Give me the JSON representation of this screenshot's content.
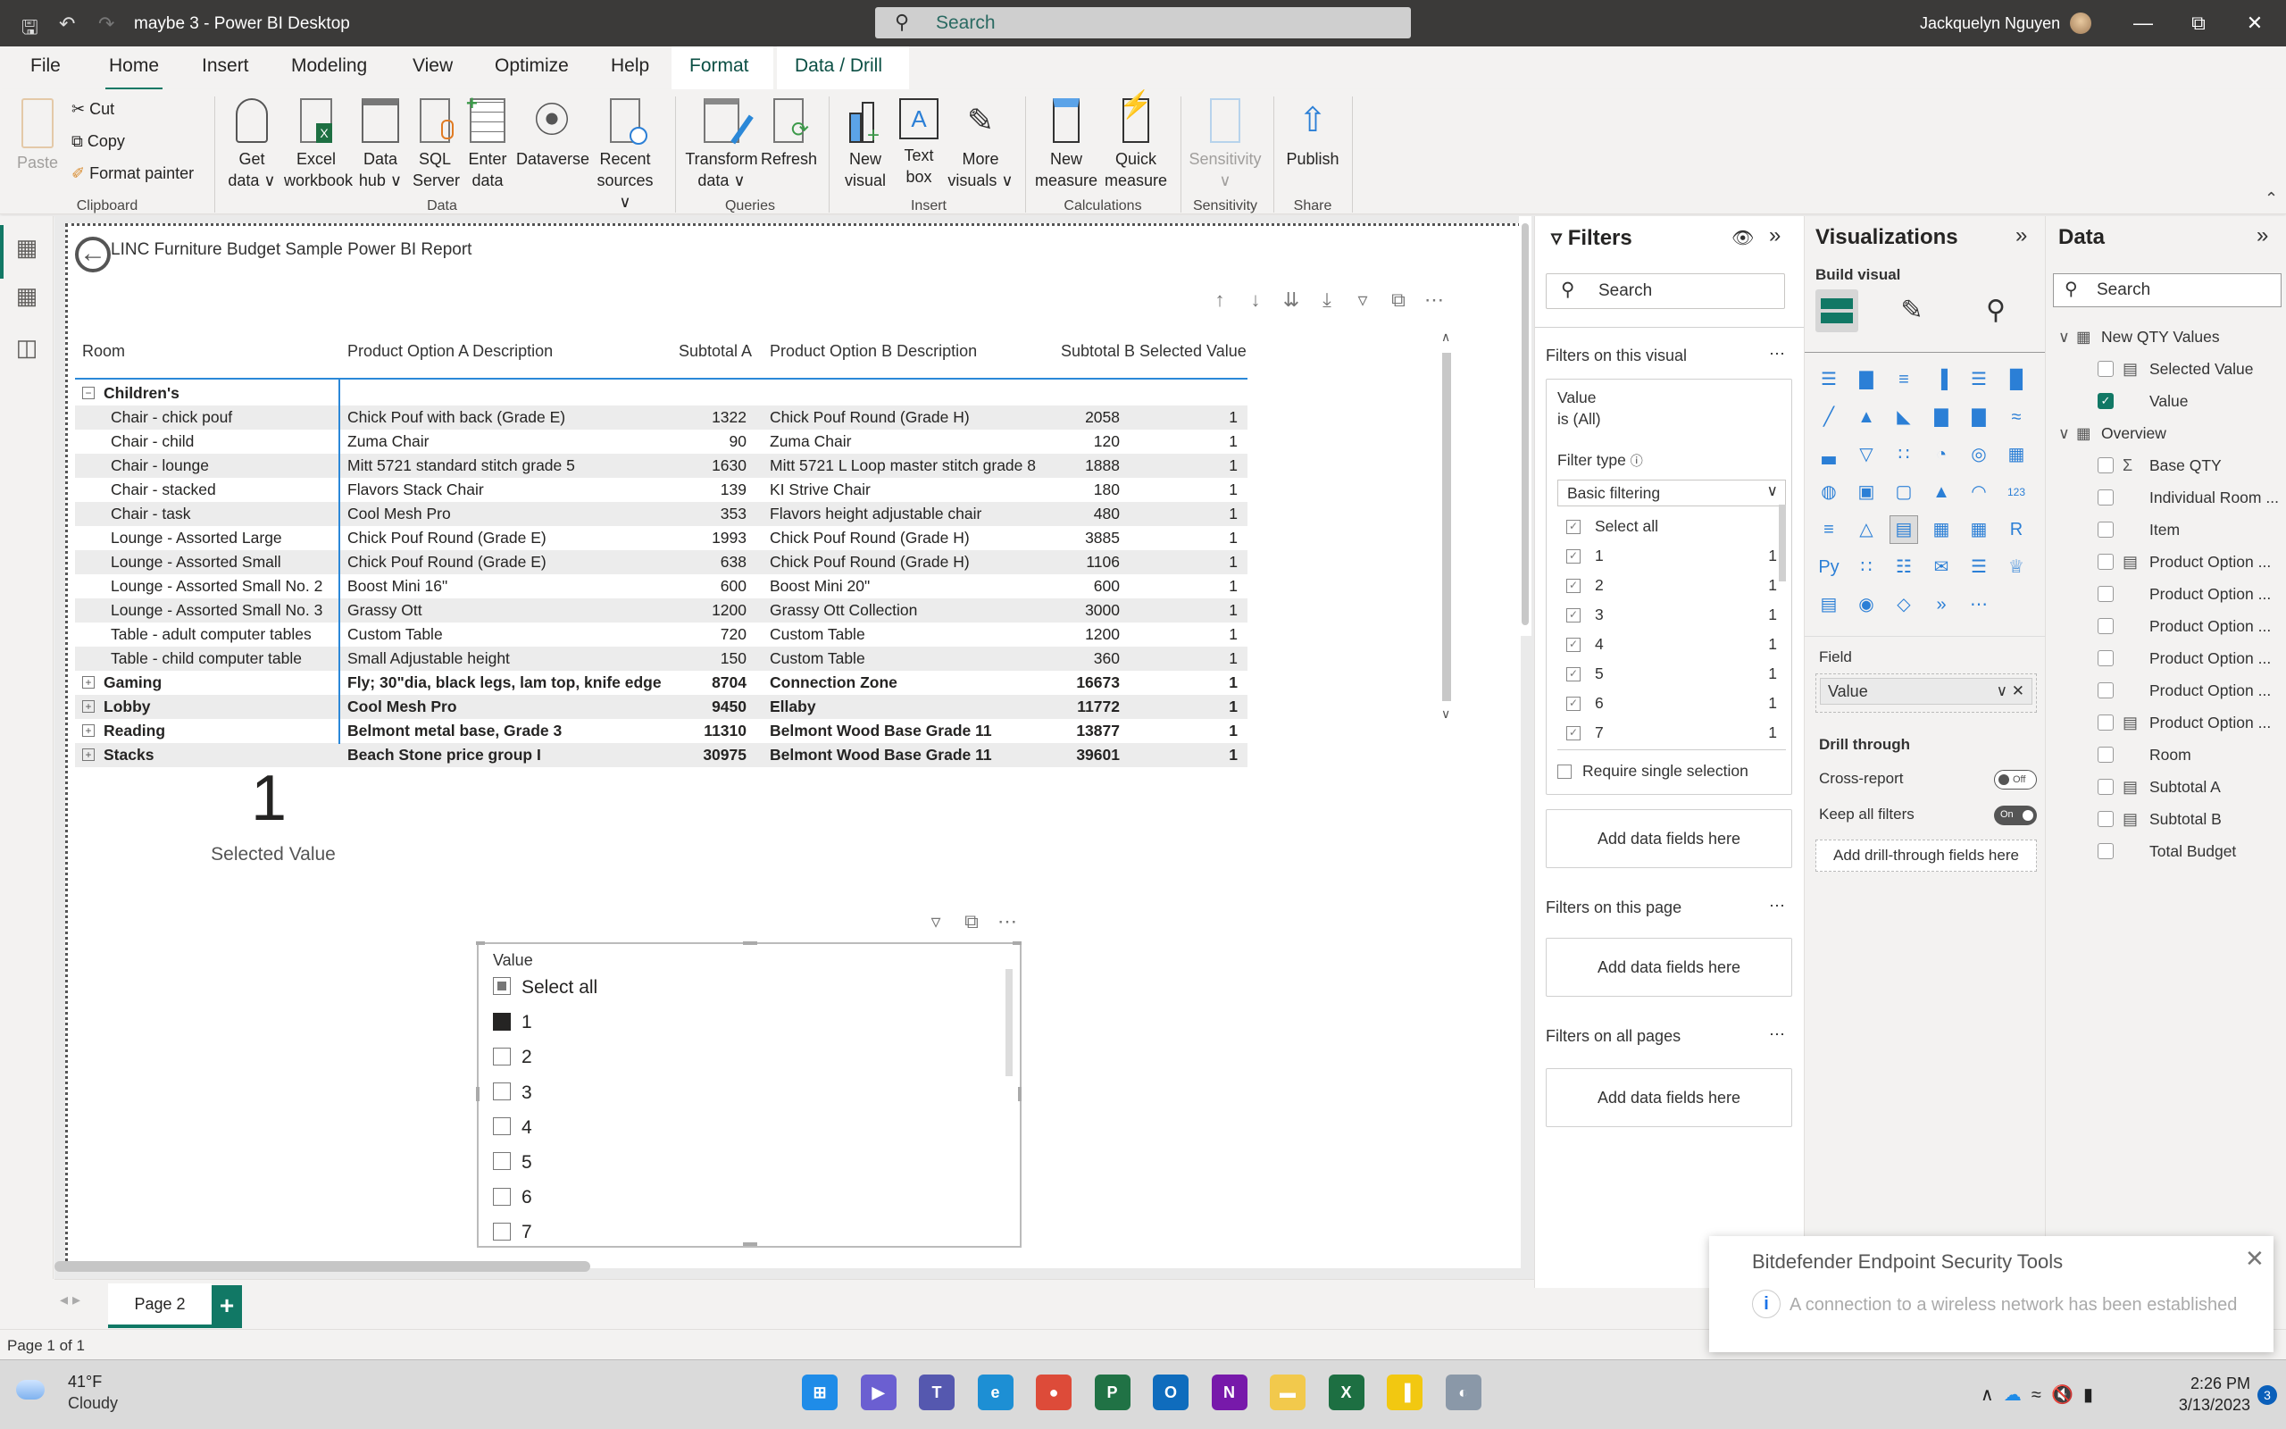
{
  "window": {
    "title": "maybe 3 - Power BI Desktop",
    "search_placeholder": "Search",
    "user_name": "Jackquelyn Nguyen"
  },
  "menu": {
    "tabs": [
      "File",
      "Home",
      "Insert",
      "Modeling",
      "View",
      "Optimize",
      "Help"
    ],
    "active_tab": "Home",
    "context_tabs": [
      "Format",
      "Data / Drill"
    ]
  },
  "ribbon": {
    "clipboard": {
      "paste": "Paste",
      "cut": "Cut",
      "copy": "Copy",
      "format_painter": "Format painter",
      "group": "Clipboard"
    },
    "data": {
      "buttons": [
        {
          "l1": "Get",
          "l2": "data ∨"
        },
        {
          "l1": "Excel",
          "l2": "workbook"
        },
        {
          "l1": "Data",
          "l2": "hub ∨"
        },
        {
          "l1": "SQL",
          "l2": "Server"
        },
        {
          "l1": "Enter",
          "l2": "data"
        },
        {
          "l1": "Dataverse",
          "l2": ""
        },
        {
          "l1": "Recent",
          "l2": "sources ∨"
        }
      ],
      "group": "Data"
    },
    "queries": {
      "transform_l1": "Transform",
      "transform_l2": "data ∨",
      "refresh": "Refresh",
      "group": "Queries"
    },
    "insert": {
      "new_visual_l1": "New",
      "new_visual_l2": "visual",
      "text_box_l1": "Text",
      "text_box_l2": "box",
      "more_visuals_l1": "More",
      "more_visuals_l2": "visuals ∨",
      "group": "Insert"
    },
    "calculations": {
      "new_measure_l1": "New",
      "new_measure_l2": "measure",
      "quick_measure_l1": "Quick",
      "quick_measure_l2": "measure",
      "group": "Calculations"
    },
    "sensitivity": {
      "label": "Sensitivity",
      "group": "Sensitivity"
    },
    "share": {
      "publish": "Publish",
      "group": "Share"
    }
  },
  "report": {
    "title": "LINC Furniture Budget Sample Power BI Report",
    "matrix": {
      "headers": [
        "Room",
        "Product Option A Description",
        "Subtotal A",
        "Product Option B Description",
        "Subtotal B",
        "Selected Value"
      ],
      "rows": [
        {
          "level": 0,
          "expander": "⊟",
          "room": "Children's",
          "a_desc": "",
          "a_sub": "",
          "b_desc": "",
          "b_sub": "",
          "sel": ""
        },
        {
          "level": 1,
          "room": "Chair - chick pouf",
          "a_desc": "Chick Pouf with back (Grade E)",
          "a_sub": "1322",
          "b_desc": "Chick Pouf Round (Grade H)",
          "b_sub": "2058",
          "sel": "1"
        },
        {
          "level": 1,
          "room": "Chair - child",
          "a_desc": "Zuma Chair",
          "a_sub": "90",
          "b_desc": "Zuma Chair",
          "b_sub": "120",
          "sel": "1"
        },
        {
          "level": 1,
          "room": "Chair - lounge",
          "a_desc": "Mitt 5721 standard stitch grade 5",
          "a_sub": "1630",
          "b_desc": "Mitt 5721 L Loop master stitch grade 8",
          "b_sub": "1888",
          "sel": "1"
        },
        {
          "level": 1,
          "room": "Chair - stacked",
          "a_desc": "Flavors Stack Chair",
          "a_sub": "139",
          "b_desc": "KI Strive Chair",
          "b_sub": "180",
          "sel": "1"
        },
        {
          "level": 1,
          "room": "Chair - task",
          "a_desc": "Cool Mesh Pro",
          "a_sub": "353",
          "b_desc": "Flavors height adjustable chair",
          "b_sub": "480",
          "sel": "1"
        },
        {
          "level": 1,
          "room": "Lounge - Assorted Large",
          "a_desc": "Chick Pouf Round (Grade E)",
          "a_sub": "1993",
          "b_desc": "Chick Pouf Round (Grade H)",
          "b_sub": "3885",
          "sel": "1"
        },
        {
          "level": 1,
          "room": "Lounge - Assorted Small",
          "a_desc": "Chick Pouf Round (Grade E)",
          "a_sub": "638",
          "b_desc": "Chick Pouf Round (Grade H)",
          "b_sub": "1106",
          "sel": "1"
        },
        {
          "level": 1,
          "room": "Lounge - Assorted Small No. 2",
          "a_desc": "Boost Mini 16\"",
          "a_sub": "600",
          "b_desc": "Boost Mini 20\"",
          "b_sub": "600",
          "sel": "1"
        },
        {
          "level": 1,
          "room": "Lounge - Assorted Small No. 3",
          "a_desc": "Grassy Ott",
          "a_sub": "1200",
          "b_desc": "Grassy Ott Collection",
          "b_sub": "3000",
          "sel": "1"
        },
        {
          "level": 1,
          "room": "Table - adult computer tables",
          "a_desc": "Custom Table",
          "a_sub": "720",
          "b_desc": "Custom Table",
          "b_sub": "1200",
          "sel": "1"
        },
        {
          "level": 1,
          "room": "Table - child computer table",
          "a_desc": "Small Adjustable height",
          "a_sub": "150",
          "b_desc": "Custom Table",
          "b_sub": "360",
          "sel": "1"
        },
        {
          "level": 0,
          "expander": "⊞",
          "room": "Gaming",
          "a_desc": "Fly; 30\"dia, black legs, lam top, knife edge",
          "a_sub": "8704",
          "b_desc": "Connection Zone",
          "b_sub": "16673",
          "sel": "1"
        },
        {
          "level": 0,
          "expander": "⊞",
          "room": "Lobby",
          "a_desc": "Cool Mesh Pro",
          "a_sub": "9450",
          "b_desc": "Ellaby",
          "b_sub": "11772",
          "sel": "1"
        },
        {
          "level": 0,
          "expander": "⊞",
          "room": "Reading",
          "a_desc": "Belmont metal base, Grade 3",
          "a_sub": "11310",
          "b_desc": "Belmont Wood Base Grade 11",
          "b_sub": "13877",
          "sel": "1"
        },
        {
          "level": 0,
          "expander": "⊞",
          "room": "Stacks",
          "a_desc": "Beach Stone price group I",
          "a_sub": "30975",
          "b_desc": "Belmont Wood Base Grade 11",
          "b_sub": "39601",
          "sel": "1"
        }
      ]
    },
    "card": {
      "value": "1",
      "label": "Selected Value"
    },
    "slicer": {
      "title": "Value",
      "items": [
        {
          "label": "Select all",
          "state": "partial"
        },
        {
          "label": "1",
          "state": "checked"
        },
        {
          "label": "2",
          "state": "unchecked"
        },
        {
          "label": "3",
          "state": "unchecked"
        },
        {
          "label": "4",
          "state": "unchecked"
        },
        {
          "label": "5",
          "state": "unchecked"
        },
        {
          "label": "6",
          "state": "unchecked"
        },
        {
          "label": "7",
          "state": "unchecked"
        }
      ]
    }
  },
  "pages": {
    "tabs": [
      "Page 2"
    ],
    "add": "+",
    "status": "Page 1 of 1"
  },
  "filters": {
    "title": "Filters",
    "search_placeholder": "Search",
    "on_visual": "Filters on this visual",
    "card": {
      "field": "Value",
      "condition": "is (All)",
      "filter_type_label": "Filter type",
      "filter_type": "Basic filtering",
      "items": [
        {
          "label": "Select all",
          "count": ""
        },
        {
          "label": "1",
          "count": "1"
        },
        {
          "label": "2",
          "count": "1"
        },
        {
          "label": "3",
          "count": "1"
        },
        {
          "label": "4",
          "count": "1"
        },
        {
          "label": "5",
          "count": "1"
        },
        {
          "label": "6",
          "count": "1"
        },
        {
          "label": "7",
          "count": "1"
        }
      ],
      "require_single": "Require single selection"
    },
    "add_fields": "Add data fields here",
    "on_page": "Filters on this page",
    "on_all_pages": "Filters on all pages"
  },
  "visualizations": {
    "title": "Visualizations",
    "build_visual": "Build visual",
    "field_label": "Field",
    "field_value": "Value",
    "drill_through": "Drill through",
    "cross_report": "Cross-report",
    "cross_report_state": "Off",
    "keep_filters": "Keep all filters",
    "keep_filters_state": "On",
    "add_drill": "Add drill-through fields here",
    "icons": [
      "stacked-bar",
      "stacked-column",
      "clustered-bar",
      "clustered-column",
      "100-bar",
      "100-column",
      "line",
      "area",
      "stacked-area",
      "line-column",
      "line-clustered",
      "ribbon",
      "waterfall",
      "funnel",
      "scatter",
      "pie",
      "donut",
      "treemap",
      "map",
      "filled-map",
      "shape-map",
      "azure-map",
      "gauge",
      "card",
      "multi-row-card",
      "kpi",
      "slicer",
      "table",
      "matrix",
      "r-visual",
      "python-visual",
      "key-influencers",
      "decomposition-tree",
      "qa",
      "smart-narrative",
      "metrics",
      "paginated",
      "arcgis",
      "power-apps",
      "power-automate",
      "more"
    ]
  },
  "data_pane": {
    "title": "Data",
    "search_placeholder": "Search",
    "tables": [
      {
        "name": "New QTY Values",
        "fields": [
          {
            "name": "Selected Value",
            "checked": false,
            "icon": "calc"
          },
          {
            "name": "Value",
            "checked": true,
            "icon": ""
          }
        ]
      },
      {
        "name": "Overview",
        "fields": [
          {
            "name": "Base QTY",
            "checked": false,
            "icon": "sigma-table"
          },
          {
            "name": "Individual Room ...",
            "checked": false,
            "icon": ""
          },
          {
            "name": "Item",
            "checked": false,
            "icon": ""
          },
          {
            "name": "Product Option ...",
            "checked": false,
            "icon": "calc"
          },
          {
            "name": "Product Option ...",
            "checked": false,
            "icon": ""
          },
          {
            "name": "Product Option ...",
            "checked": false,
            "icon": ""
          },
          {
            "name": "Product Option ...",
            "checked": false,
            "icon": ""
          },
          {
            "name": "Product Option ...",
            "checked": false,
            "icon": ""
          },
          {
            "name": "Product Option ...",
            "checked": false,
            "icon": "calc"
          },
          {
            "name": "Room",
            "checked": false,
            "icon": ""
          },
          {
            "name": "Subtotal A",
            "checked": false,
            "icon": "calc"
          },
          {
            "name": "Subtotal B",
            "checked": false,
            "icon": "calc"
          },
          {
            "name": "Total Budget",
            "checked": false,
            "icon": ""
          }
        ]
      }
    ]
  },
  "notification": {
    "title": "Bitdefender Endpoint Security Tools",
    "message": "A connection to a wireless network has been established"
  },
  "taskbar": {
    "temperature": "41°F",
    "condition": "Cloudy",
    "apps": [
      {
        "name": "start",
        "glyph": "⊞",
        "color": "#1f8ce8"
      },
      {
        "name": "meet",
        "glyph": "▶",
        "color": "#6b5fd1"
      },
      {
        "name": "teams",
        "glyph": "T",
        "color": "#5558af"
      },
      {
        "name": "edge",
        "glyph": "e",
        "color": "#1d8fd4"
      },
      {
        "name": "chrome",
        "glyph": "●",
        "color": "#dd4b39"
      },
      {
        "name": "project",
        "glyph": "P",
        "color": "#207245"
      },
      {
        "name": "outlook",
        "glyph": "O",
        "color": "#0f6cbd"
      },
      {
        "name": "onenote",
        "glyph": "N",
        "color": "#7719aa"
      },
      {
        "name": "file-explorer",
        "glyph": "▬",
        "color": "#f2c94c"
      },
      {
        "name": "excel",
        "glyph": "X",
        "color": "#1d6f42"
      },
      {
        "name": "power-bi",
        "glyph": "▐",
        "color": "#f2c811"
      },
      {
        "name": "google-earth-pro",
        "glyph": "◐",
        "color": "#8a98a8"
      }
    ],
    "time": "2:26 PM",
    "date": "3/13/2023",
    "notification_count": "3"
  }
}
